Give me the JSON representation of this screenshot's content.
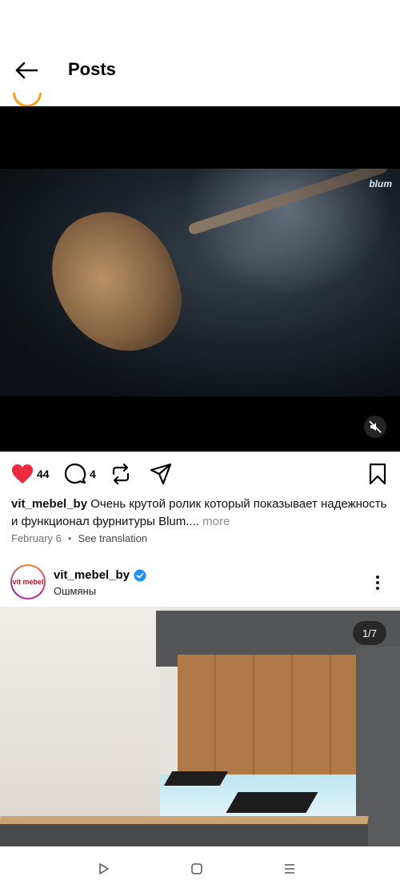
{
  "header": {
    "title": "Posts"
  },
  "post1": {
    "brand_tag": "blum",
    "likes": "44",
    "comments": "4",
    "username": "vit_mebel_by",
    "caption": "Очень крутой ролик который показывает надежность и функционал фурнитуры Blum....",
    "more_label": "more",
    "date": "February 6",
    "see_translation": "See translation"
  },
  "post2": {
    "username": "vit_mebel_by",
    "location": "Ошмяны",
    "avatar_text": "vit mebel",
    "carousel_counter": "1/7"
  },
  "colors": {
    "like_red": "#ed2a3d",
    "verified_blue": "#1f8fff"
  }
}
